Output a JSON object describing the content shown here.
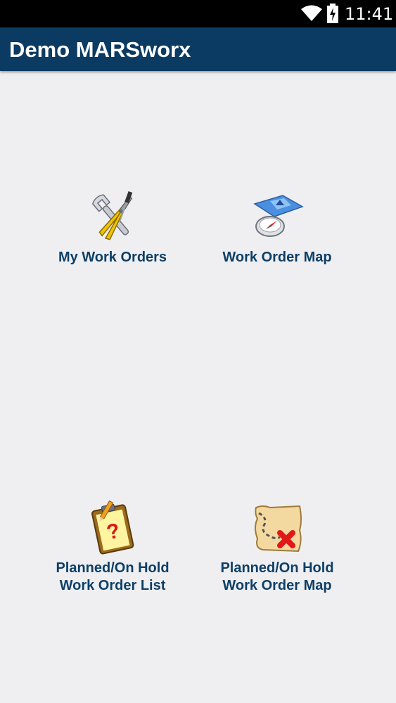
{
  "status_bar": {
    "time": "11:41",
    "icons": [
      "wifi-icon",
      "battery-charging-icon"
    ]
  },
  "app_bar": {
    "title": "Demo MARSworx",
    "background_color": "#0b3a62"
  },
  "menu": {
    "label_color": "#0d3f67",
    "items": [
      {
        "icon": "tools-icon",
        "label": "My Work Orders"
      },
      {
        "icon": "map-compass-icon",
        "label": "Work Order Map"
      },
      {
        "icon": "clipboard-question-icon",
        "label": "Planned/On Hold\nWork Order List"
      },
      {
        "icon": "treasure-map-icon",
        "label": "Planned/On Hold\nWork Order Map"
      }
    ]
  }
}
